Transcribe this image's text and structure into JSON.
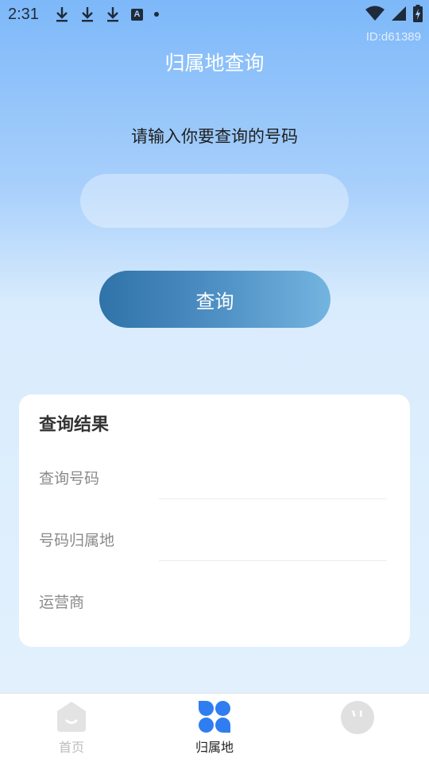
{
  "status_bar": {
    "time": "2:31",
    "icons_left": [
      "download-icon",
      "download-icon",
      "download-icon",
      "a-icon",
      "dot-icon"
    ],
    "icons_right": [
      "wifi-icon",
      "signal-icon",
      "battery-charging-icon"
    ]
  },
  "watermark": "ID:d61389",
  "page": {
    "title": "归属地查询",
    "prompt": "请输入你要查询的号码"
  },
  "search": {
    "value": "",
    "placeholder": ""
  },
  "query_button": {
    "label": "查询"
  },
  "result": {
    "title": "查询结果",
    "rows": [
      {
        "label": "查询号码",
        "value": ""
      },
      {
        "label": "号码归属地",
        "value": ""
      },
      {
        "label": "运营商",
        "value": ""
      }
    ]
  },
  "bottom_nav": {
    "items": [
      {
        "label": "首页",
        "icon": "home-icon",
        "active": false
      },
      {
        "label": "归属地",
        "icon": "clover-icon",
        "active": true
      },
      {
        "label": "",
        "icon": "face-icon",
        "active": false
      }
    ]
  },
  "colors": {
    "accent_blue": "#2f7df0",
    "button_gradient_start": "#2f73a8",
    "button_gradient_end": "#74b4e0",
    "inactive_gray": "#bdbdbd"
  }
}
